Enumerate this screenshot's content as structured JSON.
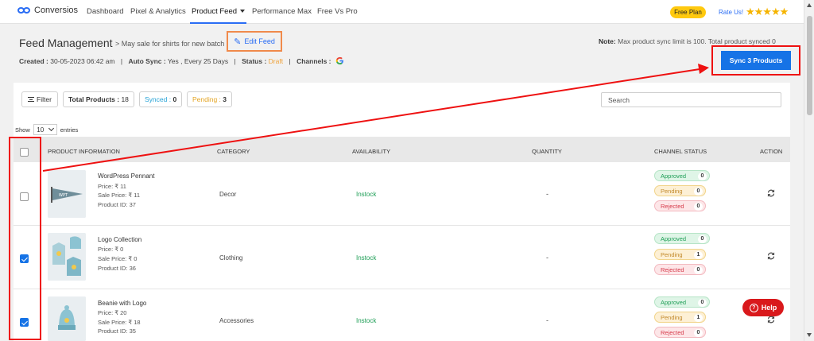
{
  "nav": {
    "brand": "Conversios",
    "tabs": [
      "Dashboard",
      "Pixel & Analytics",
      "Product Feed",
      "Performance Max",
      "Free Vs Pro"
    ],
    "plan_badge": "Free Plan",
    "rate_us": "Rate Us!",
    "stars": "★★★★★"
  },
  "header": {
    "title": "Feed Management",
    "feed_desc": "> May sale for shirts for new batch",
    "edit_label": "Edit Feed",
    "created_label": "Created :",
    "created_value": "30-05-2023 06:42 am",
    "autosync_label": "Auto Sync :",
    "autosync_value": "Yes , Every 25 Days",
    "status_label": "Status :",
    "status_value": "Draft",
    "channels_label": "Channels :",
    "note_label": "Note:",
    "note_text": "Max product sync limit is 100. Total product synced 0",
    "sync_button": "Sync 3 Products"
  },
  "toolbar": {
    "filter_label": "Filter",
    "total_label": "Total Products :",
    "total_value": "18",
    "synced_label": "Synced :",
    "synced_value": "0",
    "pending_label": "Pending :",
    "pending_value": "3",
    "search_placeholder": "Search",
    "show_label": "Show",
    "entries_value": "10",
    "entries_label": "entries"
  },
  "table": {
    "columns": [
      "PRODUCT INFORMATION",
      "CATEGORY",
      "AVAILABILITY",
      "QUANTITY",
      "CHANNEL STATUS",
      "ACTION"
    ],
    "status_labels": {
      "approved": "Approved",
      "pending": "Pending",
      "rejected": "Rejected"
    },
    "rows": [
      {
        "name": "WordPress Pennant",
        "price": "Price: ₹ 11",
        "sale": "Sale Price: ₹ 11",
        "id": "Product ID: 37",
        "category": "Decor",
        "availability": "Instock",
        "quantity": "-",
        "approved": "0",
        "pending": "0",
        "rejected": "0",
        "checked": false
      },
      {
        "name": "Logo Collection",
        "price": "Price: ₹ 0",
        "sale": "Sale Price: ₹ 0",
        "id": "Product ID: 36",
        "category": "Clothing",
        "availability": "Instock",
        "quantity": "-",
        "approved": "0",
        "pending": "1",
        "rejected": "0",
        "checked": true
      },
      {
        "name": "Beanie with Logo",
        "price": "Price: ₹ 20",
        "sale": "Sale Price: ₹ 18",
        "id": "Product ID: 35",
        "category": "Accessories",
        "availability": "Instock",
        "quantity": "-",
        "approved": "0",
        "pending": "1",
        "rejected": "0",
        "checked": true
      }
    ]
  },
  "help_label": "Help",
  "colors": {
    "accent": "#1673e6",
    "annotation_red": "#e11111",
    "draft": "#f0a23a",
    "instock": "#1e9e56"
  }
}
